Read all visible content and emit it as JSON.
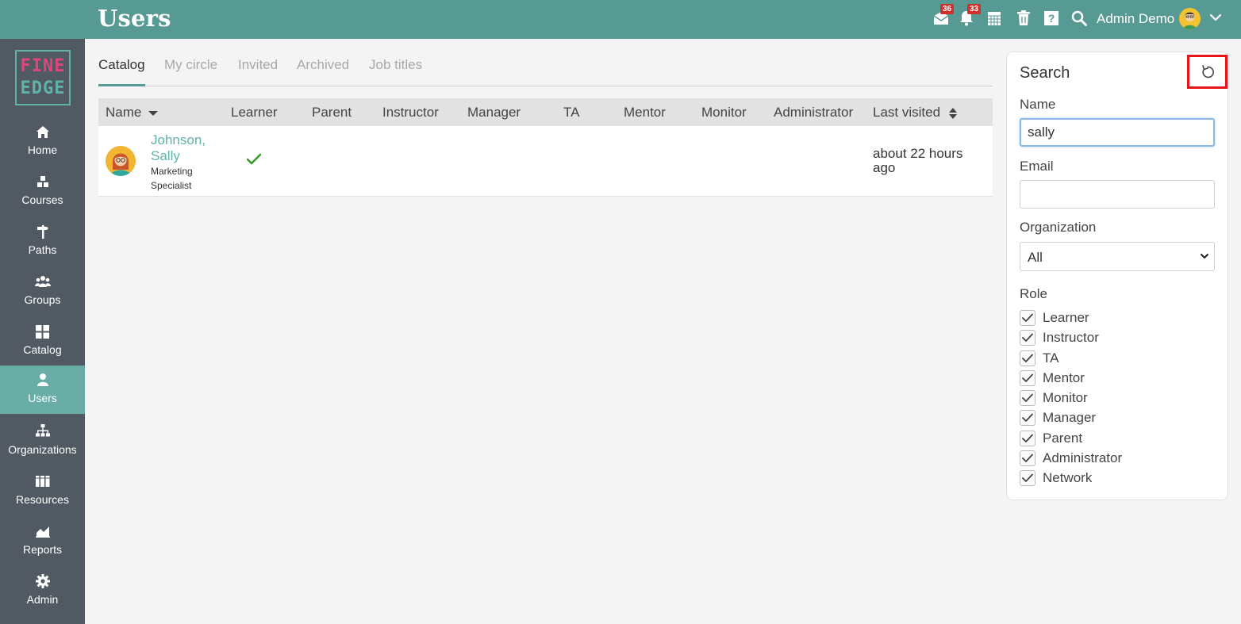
{
  "header": {
    "title": "Users",
    "messages_badge": "36",
    "notifications_badge": "33",
    "user_name": "Admin Demo"
  },
  "logo": {
    "line1": "FINE",
    "line2": "EDGE"
  },
  "sidebar": {
    "items": [
      {
        "label": "Home",
        "icon": "home-icon"
      },
      {
        "label": "Courses",
        "icon": "courses-icon"
      },
      {
        "label": "Paths",
        "icon": "paths-icon"
      },
      {
        "label": "Groups",
        "icon": "groups-icon"
      },
      {
        "label": "Catalog",
        "icon": "catalog-icon"
      },
      {
        "label": "Users",
        "icon": "user-icon",
        "active": true
      },
      {
        "label": "Organizations",
        "icon": "org-chart-icon"
      },
      {
        "label": "Resources",
        "icon": "books-icon"
      },
      {
        "label": "Reports",
        "icon": "chart-icon"
      },
      {
        "label": "Admin",
        "icon": "gear-icon"
      }
    ]
  },
  "tabs": [
    {
      "label": "Catalog",
      "active": true
    },
    {
      "label": "My circle"
    },
    {
      "label": "Invited"
    },
    {
      "label": "Archived"
    },
    {
      "label": "Job titles"
    }
  ],
  "table": {
    "columns": [
      "Name",
      "Learner",
      "Parent",
      "Instructor",
      "Manager",
      "TA",
      "Mentor",
      "Monitor",
      "Administrator",
      "Last visited"
    ],
    "rows": [
      {
        "name": "Johnson, Sally",
        "job_title": "Marketing Specialist",
        "learner": true,
        "last_visited": "about 22 hours ago"
      }
    ]
  },
  "search": {
    "title": "Search",
    "name_label": "Name",
    "name_value": "sally",
    "email_label": "Email",
    "email_value": "",
    "organization_label": "Organization",
    "organization_value": "All",
    "role_label": "Role",
    "roles": [
      {
        "label": "Learner",
        "checked": true
      },
      {
        "label": "Instructor",
        "checked": true
      },
      {
        "label": "TA",
        "checked": true
      },
      {
        "label": "Mentor",
        "checked": true
      },
      {
        "label": "Monitor",
        "checked": true
      },
      {
        "label": "Manager",
        "checked": true
      },
      {
        "label": "Parent",
        "checked": true
      },
      {
        "label": "Administrator",
        "checked": true
      },
      {
        "label": "Network",
        "checked": true
      }
    ]
  },
  "colors": {
    "brand": "#579a94",
    "sidebar": "#515a63",
    "sidebar_active": "#6aada6",
    "link": "#5fb3a9",
    "highlight": "#e8141a"
  }
}
